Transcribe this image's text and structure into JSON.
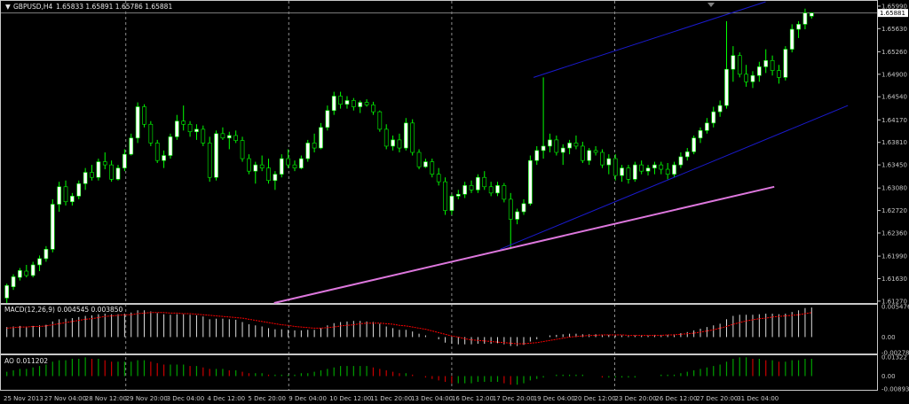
{
  "main_panel": {
    "symbol": "GBPUSD,H4",
    "ohlc": "1.65833 1.65891 1.65786 1.65881",
    "current_price_label": "1.65881",
    "price_ticks": [
      "1.65990",
      "1.65630",
      "1.65260",
      "1.64900",
      "1.64540",
      "1.64170",
      "1.63810",
      "1.63450",
      "1.63080",
      "1.62720",
      "1.62360",
      "1.61990",
      "1.61630",
      "1.61270"
    ],
    "menu_arrow_glyph": "▼"
  },
  "macd_panel": {
    "label": "MACD(12,26,9) 0.004545 0.003850",
    "ticks": [
      "0.005476",
      "0.00",
      "-0.002788"
    ]
  },
  "ao_panel": {
    "label": "AO 0.011202",
    "ticks": [
      "0.01322",
      "0.00",
      "-0.00893"
    ]
  },
  "time_axis": {
    "labels": [
      "25 Nov 2013",
      "27 Nov 04:00",
      "28 Nov 12:00",
      "29 Nov 20:00",
      "3 Dec 04:00",
      "4 Dec 12:00",
      "5 Dec 20:00",
      "9 Dec 04:00",
      "10 Dec 12:00",
      "11 Dec 20:00",
      "13 Dec 04:00",
      "16 Dec 12:00",
      "17 Dec 20:00",
      "19 Dec 04:00",
      "20 Dec 12:00",
      "23 Dec 20:00",
      "26 Dec 12:00",
      "27 Dec 20:00",
      "31 Dec 04:00"
    ]
  },
  "colors": {
    "background": "#000000",
    "bull_body": "#ffffff",
    "bull_wick": "#00ff00",
    "bear_body": "#000000",
    "bear_wick": "#00ff00",
    "grid": "#c8c8c8",
    "channel": "#1a1acd",
    "trendline": "#dd77dd",
    "macd_hist": "#dddddd",
    "macd_signal": "#ff0000",
    "ao_up": "#00a000",
    "ao_down": "#c80000",
    "text": "#c8c8c8",
    "current_price_bg": "#ffffff"
  },
  "chart_data": {
    "type": "candlestick",
    "ylim": [
      1.6124,
      1.6606
    ],
    "candles": [
      [
        1.6132,
        1.6155,
        1.6124,
        1.6152
      ],
      [
        1.615,
        1.617,
        1.6145,
        1.6166
      ],
      [
        1.6165,
        1.618,
        1.616,
        1.6176
      ],
      [
        1.6175,
        1.6185,
        1.6165,
        1.6168
      ],
      [
        1.6168,
        1.619,
        1.6165,
        1.6185
      ],
      [
        1.6185,
        1.62,
        1.6175,
        1.6195
      ],
      [
        1.6195,
        1.6215,
        1.619,
        1.621
      ],
      [
        1.621,
        1.629,
        1.6205,
        1.6282
      ],
      [
        1.6282,
        1.6318,
        1.627,
        1.631
      ],
      [
        1.631,
        1.632,
        1.628,
        1.6286
      ],
      [
        1.6286,
        1.63,
        1.628,
        1.6295
      ],
      [
        1.6295,
        1.632,
        1.629,
        1.6315
      ],
      [
        1.6315,
        1.634,
        1.6305,
        1.6333
      ],
      [
        1.6333,
        1.6345,
        1.632,
        1.6325
      ],
      [
        1.6325,
        1.6355,
        1.632,
        1.635
      ],
      [
        1.635,
        1.6365,
        1.6338,
        1.6345
      ],
      [
        1.6345,
        1.6352,
        1.6318,
        1.6322
      ],
      [
        1.6322,
        1.6345,
        1.632,
        1.634
      ],
      [
        1.634,
        1.637,
        1.6335,
        1.6362
      ],
      [
        1.6362,
        1.6395,
        1.636,
        1.6388
      ],
      [
        1.6388,
        1.6445,
        1.638,
        1.6438
      ],
      [
        1.6438,
        1.6442,
        1.6405,
        1.641
      ],
      [
        1.641,
        1.6415,
        1.6375,
        1.638
      ],
      [
        1.638,
        1.6385,
        1.6348,
        1.6352
      ],
      [
        1.6352,
        1.6368,
        1.634,
        1.636
      ],
      [
        1.636,
        1.6395,
        1.6355,
        1.639
      ],
      [
        1.639,
        1.6425,
        1.6385,
        1.6415
      ],
      [
        1.6415,
        1.644,
        1.64,
        1.641
      ],
      [
        1.641,
        1.6415,
        1.639,
        1.6398
      ],
      [
        1.6398,
        1.641,
        1.6385,
        1.6402
      ],
      [
        1.6402,
        1.6408,
        1.6375,
        1.638
      ],
      [
        1.638,
        1.639,
        1.6318,
        1.6325
      ],
      [
        1.6325,
        1.64,
        1.632,
        1.6395
      ],
      [
        1.6395,
        1.6405,
        1.6385,
        1.6388
      ],
      [
        1.6388,
        1.6398,
        1.637,
        1.6392
      ],
      [
        1.6392,
        1.64,
        1.638,
        1.6384
      ],
      [
        1.6384,
        1.639,
        1.635,
        1.6355
      ],
      [
        1.6355,
        1.6362,
        1.633,
        1.6335
      ],
      [
        1.6335,
        1.635,
        1.6315,
        1.6345
      ],
      [
        1.6345,
        1.636,
        1.6335,
        1.634
      ],
      [
        1.634,
        1.6355,
        1.6315,
        1.632
      ],
      [
        1.632,
        1.6335,
        1.6305,
        1.633
      ],
      [
        1.633,
        1.6362,
        1.6325,
        1.6355
      ],
      [
        1.6355,
        1.637,
        1.634,
        1.6345
      ],
      [
        1.6345,
        1.6352,
        1.6335,
        1.634
      ],
      [
        1.634,
        1.636,
        1.6338,
        1.6355
      ],
      [
        1.6355,
        1.6385,
        1.635,
        1.638
      ],
      [
        1.638,
        1.6395,
        1.6365,
        1.6372
      ],
      [
        1.6372,
        1.6412,
        1.637,
        1.6405
      ],
      [
        1.6405,
        1.644,
        1.64,
        1.6432
      ],
      [
        1.6432,
        1.6462,
        1.6425,
        1.6455
      ],
      [
        1.6455,
        1.6462,
        1.6435,
        1.6442
      ],
      [
        1.6442,
        1.6455,
        1.6435,
        1.6448
      ],
      [
        1.6448,
        1.6452,
        1.6432,
        1.6438
      ],
      [
        1.6438,
        1.6448,
        1.6428,
        1.6445
      ],
      [
        1.6445,
        1.645,
        1.6438,
        1.6441
      ],
      [
        1.6441,
        1.6446,
        1.6425,
        1.643
      ],
      [
        1.643,
        1.6432,
        1.6398,
        1.6402
      ],
      [
        1.6402,
        1.641,
        1.637,
        1.6375
      ],
      [
        1.6375,
        1.6392,
        1.6368,
        1.6385
      ],
      [
        1.6385,
        1.6395,
        1.6365,
        1.6372
      ],
      [
        1.6372,
        1.642,
        1.6368,
        1.6412
      ],
      [
        1.6412,
        1.6418,
        1.636,
        1.6365
      ],
      [
        1.6365,
        1.637,
        1.6338,
        1.6342
      ],
      [
        1.6342,
        1.6355,
        1.634,
        1.635
      ],
      [
        1.635,
        1.6355,
        1.6325,
        1.633
      ],
      [
        1.633,
        1.634,
        1.6312,
        1.6318
      ],
      [
        1.6318,
        1.6325,
        1.6265,
        1.6272
      ],
      [
        1.6272,
        1.6298,
        1.6265,
        1.6295
      ],
      [
        1.6295,
        1.6305,
        1.629,
        1.6298
      ],
      [
        1.6298,
        1.6318,
        1.6292,
        1.6312
      ],
      [
        1.6312,
        1.632,
        1.63,
        1.6305
      ],
      [
        1.6305,
        1.633,
        1.63,
        1.6325
      ],
      [
        1.6325,
        1.6335,
        1.6305,
        1.631
      ],
      [
        1.631,
        1.6318,
        1.6295,
        1.63
      ],
      [
        1.63,
        1.6318,
        1.6295,
        1.6312
      ],
      [
        1.6312,
        1.6316,
        1.6285,
        1.629
      ],
      [
        1.629,
        1.63,
        1.621,
        1.6258
      ],
      [
        1.6258,
        1.6275,
        1.625,
        1.627
      ],
      [
        1.627,
        1.629,
        1.6265,
        1.6283
      ],
      [
        1.6283,
        1.636,
        1.628,
        1.6352
      ],
      [
        1.6352,
        1.6375,
        1.6345,
        1.6368
      ],
      [
        1.6368,
        1.6485,
        1.6355,
        1.6375
      ],
      [
        1.6375,
        1.6395,
        1.6365,
        1.6385
      ],
      [
        1.6385,
        1.6392,
        1.636,
        1.6365
      ],
      [
        1.6365,
        1.6378,
        1.6345,
        1.6372
      ],
      [
        1.6372,
        1.6385,
        1.6362,
        1.638
      ],
      [
        1.638,
        1.6392,
        1.637,
        1.6375
      ],
      [
        1.6375,
        1.6382,
        1.6348,
        1.6352
      ],
      [
        1.6352,
        1.6372,
        1.6345,
        1.6368
      ],
      [
        1.6368,
        1.6375,
        1.636,
        1.6365
      ],
      [
        1.6365,
        1.637,
        1.634,
        1.6345
      ],
      [
        1.6345,
        1.6362,
        1.633,
        1.6355
      ],
      [
        1.6355,
        1.6362,
        1.632,
        1.6328
      ],
      [
        1.6328,
        1.6345,
        1.6318,
        1.634
      ],
      [
        1.634,
        1.6345,
        1.6315,
        1.6322
      ],
      [
        1.6322,
        1.635,
        1.6318,
        1.6345
      ],
      [
        1.6345,
        1.6352,
        1.633,
        1.6335
      ],
      [
        1.6335,
        1.6345,
        1.6328,
        1.634
      ],
      [
        1.634,
        1.635,
        1.633,
        1.6345
      ],
      [
        1.6345,
        1.635,
        1.633,
        1.6338
      ],
      [
        1.6338,
        1.6348,
        1.6322,
        1.633
      ],
      [
        1.633,
        1.635,
        1.6325,
        1.6345
      ],
      [
        1.6345,
        1.6365,
        1.634,
        1.6358
      ],
      [
        1.6358,
        1.6372,
        1.6352,
        1.6366
      ],
      [
        1.6366,
        1.6392,
        1.6362,
        1.6388
      ],
      [
        1.6388,
        1.6405,
        1.638,
        1.64
      ],
      [
        1.64,
        1.642,
        1.6395,
        1.6412
      ],
      [
        1.6412,
        1.6438,
        1.6405,
        1.643
      ],
      [
        1.643,
        1.6448,
        1.6422,
        1.644
      ],
      [
        1.644,
        1.6575,
        1.6435,
        1.6498
      ],
      [
        1.6498,
        1.6535,
        1.6478,
        1.652
      ],
      [
        1.652,
        1.6525,
        1.6485,
        1.649
      ],
      [
        1.649,
        1.6505,
        1.647,
        1.6478
      ],
      [
        1.6478,
        1.6495,
        1.6468,
        1.6488
      ],
      [
        1.6488,
        1.651,
        1.6478,
        1.6502
      ],
      [
        1.6502,
        1.653,
        1.6492,
        1.6512
      ],
      [
        1.6512,
        1.652,
        1.6488,
        1.6496
      ],
      [
        1.6496,
        1.6505,
        1.6475,
        1.6485
      ],
      [
        1.6485,
        1.6535,
        1.648,
        1.653
      ],
      [
        1.653,
        1.657,
        1.6525,
        1.6562
      ],
      [
        1.6562,
        1.6575,
        1.6548,
        1.657
      ],
      [
        1.657,
        1.6595,
        1.6562,
        1.6588
      ],
      [
        1.6583,
        1.6589,
        1.6579,
        1.6588
      ]
    ],
    "trendline": {
      "points": [
        [
          0.3125,
          1.6124
        ],
        [
          0.8828,
          1.631
        ]
      ]
    },
    "channel": {
      "upper": [
        [
          0.6084,
          1.6485
        ],
        [
          0.873,
          1.6606
        ]
      ],
      "lower": [
        [
          0.5703,
          1.621
        ],
        [
          0.9668,
          1.644
        ]
      ]
    },
    "macd": {
      "ylim": [
        -0.002788,
        0.005476
      ],
      "hist": [
        0.0018,
        0.0019,
        0.002,
        0.0019,
        0.002,
        0.0021,
        0.0022,
        0.0028,
        0.0032,
        0.0033,
        0.0034,
        0.0036,
        0.0038,
        0.0039,
        0.0041,
        0.0042,
        0.0041,
        0.0041,
        0.0042,
        0.0044,
        0.0048,
        0.0048,
        0.0046,
        0.0043,
        0.0041,
        0.004,
        0.0041,
        0.0041,
        0.004,
        0.0039,
        0.0037,
        0.0032,
        0.0033,
        0.0033,
        0.0032,
        0.0031,
        0.0027,
        0.0023,
        0.0021,
        0.0019,
        0.0016,
        0.0014,
        0.0014,
        0.0013,
        0.0012,
        0.0012,
        0.0013,
        0.0013,
        0.0016,
        0.0021,
        0.0025,
        0.0027,
        0.0028,
        0.0029,
        0.0029,
        0.0028,
        0.0027,
        0.0024,
        0.0019,
        0.0016,
        0.0013,
        0.0013,
        0.001,
        0.0006,
        0.0003,
        0.0,
        -0.0004,
        -0.001,
        -0.0012,
        -0.0013,
        -0.0013,
        -0.0013,
        -0.0012,
        -0.0012,
        -0.0012,
        -0.0011,
        -0.0013,
        -0.0016,
        -0.0016,
        -0.0014,
        -0.0008,
        -0.0004,
        0.0,
        0.0003,
        0.0004,
        0.0005,
        0.0006,
        0.0006,
        0.0005,
        0.0005,
        0.0005,
        0.0004,
        0.0004,
        0.0003,
        0.0003,
        0.0002,
        0.0003,
        0.0003,
        0.0003,
        0.0004,
        0.0004,
        0.0004,
        0.0005,
        0.0007,
        0.0009,
        0.0012,
        0.0015,
        0.0018,
        0.0021,
        0.0024,
        0.0032,
        0.0038,
        0.004,
        0.004,
        0.004,
        0.0041,
        0.0042,
        0.0042,
        0.0041,
        0.0042,
        0.0045,
        0.0048,
        0.0052,
        0.0053
      ],
      "signal": [
        0.0016,
        0.0017,
        0.0018,
        0.0018,
        0.0019,
        0.0019,
        0.002,
        0.0022,
        0.0024,
        0.0026,
        0.0028,
        0.003,
        0.0032,
        0.0033,
        0.0035,
        0.0037,
        0.0038,
        0.0039,
        0.004,
        0.004,
        0.0042,
        0.0043,
        0.0044,
        0.0044,
        0.0044,
        0.0043,
        0.0043,
        0.0042,
        0.0042,
        0.0041,
        0.004,
        0.0039,
        0.0038,
        0.0037,
        0.0036,
        0.0035,
        0.0034,
        0.0032,
        0.003,
        0.0028,
        0.0026,
        0.0024,
        0.0022,
        0.0021,
        0.0019,
        0.0018,
        0.0017,
        0.0016,
        0.0016,
        0.0017,
        0.0018,
        0.002,
        0.0021,
        0.0022,
        0.0024,
        0.0025,
        0.0025,
        0.0025,
        0.0024,
        0.0023,
        0.0021,
        0.002,
        0.0018,
        0.0016,
        0.0014,
        0.0011,
        0.0008,
        0.0005,
        0.0002,
        0.0,
        -0.0003,
        -0.0005,
        -0.0006,
        -0.0007,
        -0.0008,
        -0.0009,
        -0.001,
        -0.0011,
        -0.0012,
        -0.0012,
        -0.0011,
        -0.001,
        -0.0008,
        -0.0006,
        -0.0004,
        -0.0002,
        0.0,
        0.0001,
        0.0002,
        0.0003,
        0.0003,
        0.0004,
        0.0004,
        0.0004,
        0.0004,
        0.0003,
        0.0003,
        0.0003,
        0.0003,
        0.0003,
        0.0003,
        0.0004,
        0.0004,
        0.0005,
        0.0006,
        0.0007,
        0.0009,
        0.0011,
        0.0013,
        0.0016,
        0.0019,
        0.0023,
        0.0026,
        0.0029,
        0.0031,
        0.0033,
        0.0034,
        0.0036,
        0.0037,
        0.0038,
        0.0039,
        0.004,
        0.0042,
        0.0044
      ]
    },
    "ao": {
      "ylim": [
        -0.00893,
        0.01322
      ],
      "values": [
        0.003,
        0.004,
        0.005,
        0.005,
        0.006,
        0.007,
        0.008,
        0.01,
        0.011,
        0.011,
        0.012,
        0.012,
        0.013,
        0.012,
        0.012,
        0.011,
        0.01,
        0.01,
        0.01,
        0.01,
        0.011,
        0.011,
        0.01,
        0.009,
        0.008,
        0.008,
        0.008,
        0.008,
        0.007,
        0.007,
        0.006,
        0.005,
        0.005,
        0.005,
        0.004,
        0.004,
        0.003,
        0.002,
        0.002,
        0.002,
        0.001,
        0.001,
        0.001,
        0.001,
        0.001,
        0.002,
        0.002,
        0.003,
        0.004,
        0.005,
        0.006,
        0.007,
        0.007,
        0.007,
        0.007,
        0.007,
        0.006,
        0.005,
        0.004,
        0.003,
        0.002,
        0.002,
        0.001,
        0.0,
        -0.001,
        -0.002,
        -0.003,
        -0.004,
        -0.005,
        -0.005,
        -0.005,
        -0.005,
        -0.004,
        -0.004,
        -0.004,
        -0.004,
        -0.005,
        -0.006,
        -0.006,
        -0.005,
        -0.003,
        -0.002,
        -0.001,
        0.0,
        0.001,
        0.001,
        0.001,
        0.001,
        0.001,
        0.0,
        0.0,
        -0.001,
        -0.001,
        -0.001,
        -0.001,
        -0.001,
        -0.001,
        0.0,
        0.0,
        0.0,
        0.001,
        0.001,
        0.001,
        0.002,
        0.003,
        0.004,
        0.005,
        0.006,
        0.007,
        0.008,
        0.01,
        0.012,
        0.013,
        0.013,
        0.012,
        0.012,
        0.011,
        0.011,
        0.01,
        0.01,
        0.011,
        0.011,
        0.012,
        0.012
      ]
    }
  }
}
